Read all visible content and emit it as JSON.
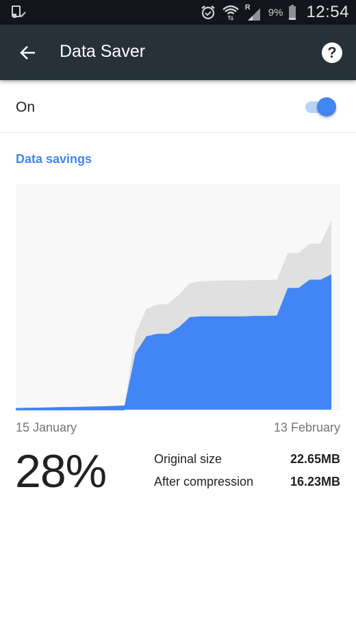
{
  "status_bar": {
    "left_icon": "screen-mirroring-check-icon",
    "icons": [
      "alarm-icon",
      "wifi-icon",
      "signal-roaming-icon",
      "battery-icon"
    ],
    "roaming_indicator": "R",
    "battery_percent": "9%",
    "time": "12:54"
  },
  "app_bar": {
    "back_icon": "arrow-back-icon",
    "title": "Data Saver",
    "help_icon": "help-icon",
    "help_glyph": "?"
  },
  "toggle": {
    "label": "On",
    "checked": true,
    "accent_color": "#4285f4",
    "track_color": "#bcd3f8"
  },
  "section": {
    "title": "Data savings"
  },
  "chart_data": {
    "type": "area",
    "title": "Data savings",
    "x_start_label": "15 January",
    "x_end_label": "13 February",
    "xlabel": "",
    "ylabel": "",
    "grid": false,
    "x": [
      0,
      1,
      2,
      3,
      4,
      5,
      6,
      7,
      8,
      9,
      10,
      11,
      12,
      13,
      14,
      15,
      16,
      17,
      18,
      19,
      20,
      21,
      22,
      23,
      24,
      25,
      26,
      27,
      28,
      29
    ],
    "series": [
      {
        "name": "Original size",
        "color": "#e0e0e0",
        "values": [
          0.2,
          0.22,
          0.25,
          0.27,
          0.3,
          0.32,
          0.35,
          0.38,
          0.4,
          0.45,
          0.5,
          9.1,
          12.1,
          12.6,
          12.7,
          13.8,
          15.2,
          15.4,
          15.45,
          15.5,
          15.5,
          15.5,
          15.55,
          15.55,
          15.6,
          18.8,
          18.8,
          19.9,
          19.9,
          22.65
        ]
      },
      {
        "name": "After compression",
        "color": "#4285f4",
        "values": [
          0.2,
          0.22,
          0.25,
          0.27,
          0.3,
          0.32,
          0.35,
          0.38,
          0.4,
          0.45,
          0.5,
          6.8,
          8.8,
          9.1,
          9.1,
          9.9,
          11.1,
          11.2,
          11.2,
          11.2,
          11.2,
          11.2,
          11.25,
          11.25,
          11.3,
          14.6,
          14.6,
          15.6,
          15.6,
          16.23
        ]
      }
    ],
    "ylim": [
      0,
      27.2
    ],
    "background_color": "#f8f8f8"
  },
  "summary": {
    "percent_saved": "28%",
    "rows": [
      {
        "label": "Original size",
        "value": "22.65MB"
      },
      {
        "label": "After compression",
        "value": "16.23MB"
      }
    ]
  }
}
